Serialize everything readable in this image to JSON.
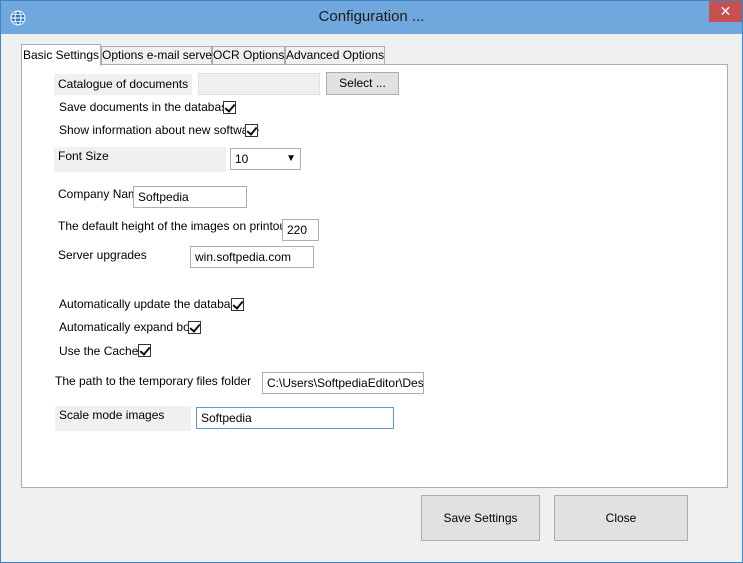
{
  "window": {
    "title": "Configuration ...",
    "close_glyph": "✕"
  },
  "tabs": [
    {
      "label": "Basic Settings",
      "active": true
    },
    {
      "label": "Options e-mail server",
      "active": false
    },
    {
      "label": "OCR Options",
      "active": false
    },
    {
      "label": "Advanced Options",
      "active": false
    }
  ],
  "basic": {
    "catalogue_label": "Catalogue of documents",
    "catalogue_value": "",
    "select_button": "Select ...",
    "save_docs_label": "Save documents in the database",
    "save_docs_checked": true,
    "show_info_label": "Show information about new software",
    "show_info_checked": true,
    "font_size_label": "Font Size",
    "font_size_value": "10",
    "company_label": "Company Name",
    "company_value": "Softpedia",
    "height_label": "The default height of the images on printouts",
    "height_value": "220",
    "server_label": "Server upgrades",
    "server_value": "win.softpedia.com",
    "auto_update_label": "Automatically update the database",
    "auto_update_checked": true,
    "auto_expand_label": "Automatically expand box",
    "auto_expand_checked": true,
    "cache_label": "Use the Cache",
    "cache_checked": true,
    "temp_path_label": "The path to the temporary files folder",
    "temp_path_value": "C:\\Users\\SoftpediaEditor\\Desktop",
    "scale_label": "Scale mode images",
    "scale_value": "Softpedia"
  },
  "footer": {
    "save_label": "Save Settings",
    "close_label": "Close"
  },
  "colors": {
    "titlebar": "#70a8de",
    "close": "#c75050",
    "focus_border": "#5b9bd5"
  }
}
